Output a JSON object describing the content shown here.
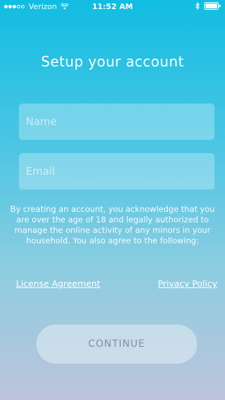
{
  "status_bar": {
    "carrier": "Verizon",
    "time": "11:52 AM",
    "signal_bars_filled": 3,
    "signal_bars_total": 5,
    "icons": [
      "wifi-icon",
      "bluetooth-icon",
      "battery-icon"
    ]
  },
  "title": "Setup your account",
  "form": {
    "name_placeholder": "Name",
    "name_value": "",
    "email_placeholder": "Email",
    "email_value": ""
  },
  "disclaimer": "By creating an account, you acknowledge that you are over the age of 18 and legally authorized to manage the online activity of any minors in your household. You also agree to the following:",
  "links": {
    "license": "License Agreement",
    "privacy": "Privacy Policy"
  },
  "continue_label": "CONTINUE",
  "colors": {
    "background_top": "#11bde2",
    "background_bottom": "#bdc4dc",
    "text": "#ffffff"
  }
}
